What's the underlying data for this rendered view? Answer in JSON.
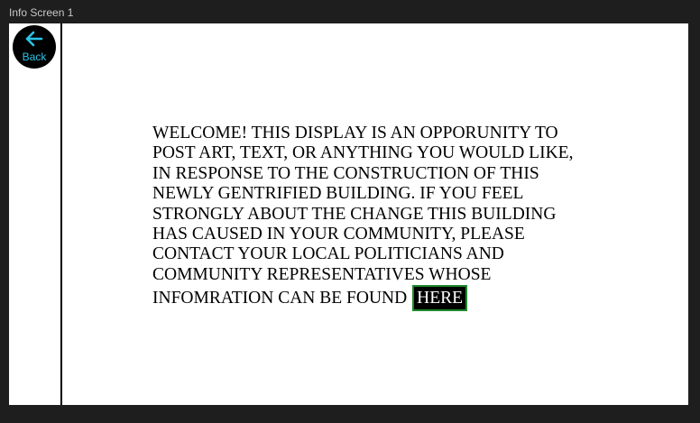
{
  "frame": {
    "title": "Info Screen 1"
  },
  "sidebar": {
    "back_button": {
      "label": "Back",
      "icon": "arrow-left-icon",
      "icon_color": "#29c4e8"
    }
  },
  "content": {
    "lines": [
      "WELCOME! THIS DISPLAY IS AN OPPORUNITY TO",
      "POST ART, TEXT, OR ANYTHING YOU WOULD LIKE,",
      "IN RESPONSE TO THE CONSTRUCTION OF THIS",
      "NEWLY GENTRIFIED BUILDING. IF YOU FEEL",
      "STRONGLY ABOUT THE CHANGE THIS BUILDING",
      "HAS CAUSED IN YOUR COMMUNITY, PLEASE",
      "CONTACT YOUR LOCAL POLITICIANS AND",
      "COMMUNITY REPRESENTATIVES WHOSE"
    ],
    "last_line": "INFOMRATION CAN BE FOUND",
    "link_label": "HERE",
    "link_border_color": "#1f8a2e"
  }
}
